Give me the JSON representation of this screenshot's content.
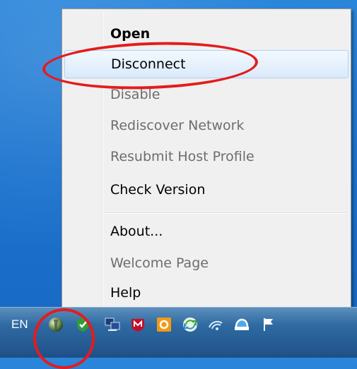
{
  "context_menu": {
    "items": [
      {
        "label": "Open",
        "bold": true,
        "disabled": false,
        "highlighted": false
      },
      {
        "label": "Disconnect",
        "bold": false,
        "disabled": false,
        "highlighted": true
      },
      {
        "label": "Disable",
        "bold": false,
        "disabled": true,
        "highlighted": false
      },
      {
        "label": "Rediscover Network",
        "bold": false,
        "disabled": true,
        "highlighted": false
      },
      {
        "label": "Resubmit Host Profile",
        "bold": false,
        "disabled": true,
        "highlighted": false
      },
      {
        "label": "Check Version",
        "bold": false,
        "disabled": false,
        "highlighted": false
      },
      {
        "label": "About...",
        "bold": false,
        "disabled": false,
        "highlighted": false
      },
      {
        "label": "Welcome Page",
        "bold": false,
        "disabled": true,
        "highlighted": false
      },
      {
        "label": "Help",
        "bold": false,
        "disabled": false,
        "highlighted": false
      }
    ]
  },
  "taskbar": {
    "language": "EN",
    "tray_icons": [
      "network-client-icon",
      "shield-check-icon",
      "network-monitor-icon",
      "mcafee-icon",
      "outlook-icon",
      "sync-icon",
      "wifi-signal-icon",
      "cloud-icon",
      "action-center-flag-icon"
    ]
  },
  "colors": {
    "annotation": "#e41c1c",
    "highlight_border": "#aecff7",
    "disabled_text": "#6d6d6d"
  }
}
